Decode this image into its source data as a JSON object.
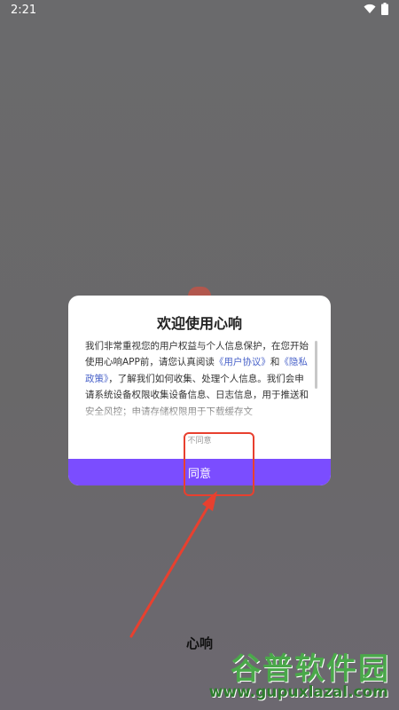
{
  "status_bar": {
    "time": "2:21",
    "icons": [
      "wifi-icon",
      "battery-icon"
    ]
  },
  "dialog": {
    "title": "欢迎使用心响",
    "body": {
      "p1": "我们非常重视您的用户权益与个人信息保护，在您开始使用心响APP前，请您认真阅读",
      "link_agreement": "《用户协议》",
      "and": "和",
      "link_privacy": "《隐私政策》",
      "p2": "，了解我们如何收集、处理个人信息。我们会申请系统设备权限收集设备信息、日志信息，用于推送和安全风控；申请存储权限用于下载缓存文"
    },
    "disagree_label": "不同意",
    "agree_label": "同意"
  },
  "app_name": "心响",
  "annotation_color": "#e8402f",
  "accent_color": "#7b4dff",
  "link_color": "#4a63c9",
  "watermark": {
    "main": "谷普软件园",
    "sub": "www.gupuxlazal.com"
  }
}
